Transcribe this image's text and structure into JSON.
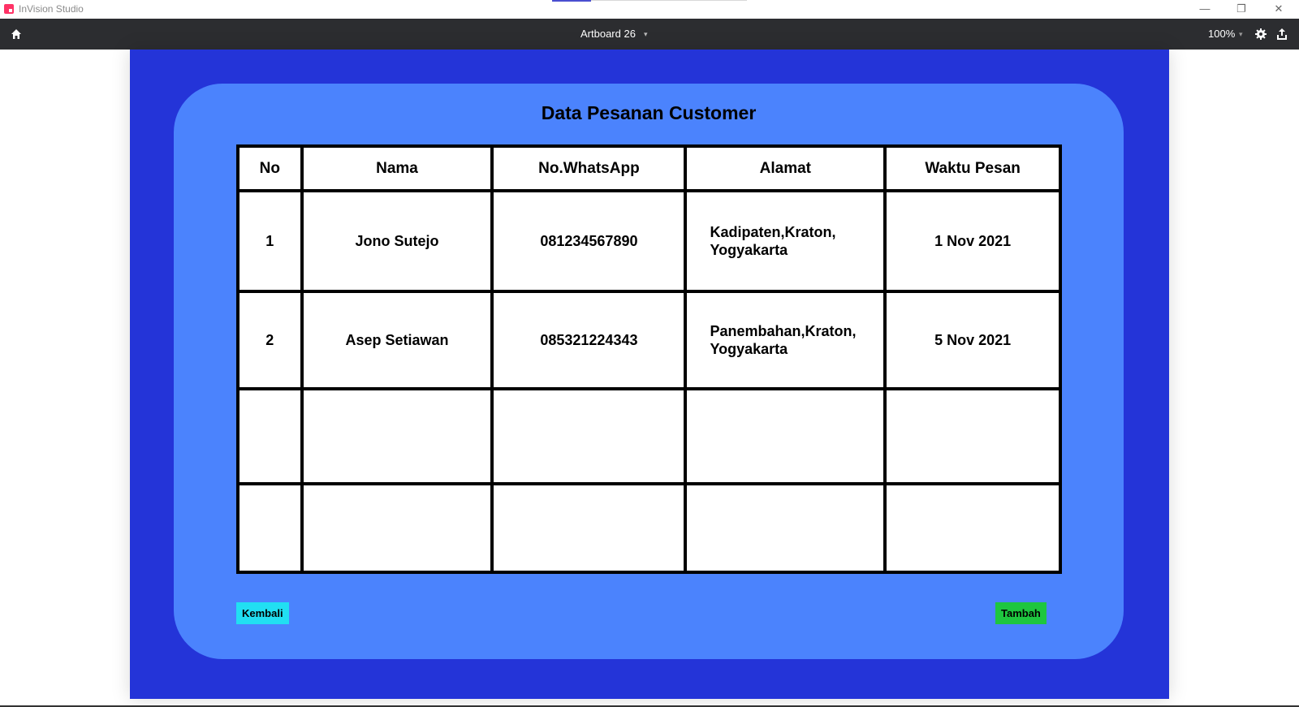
{
  "window": {
    "app_title": "InVision Studio",
    "minimize_glyph": "—",
    "maximize_glyph": "❐",
    "close_glyph": "✕"
  },
  "toolbar": {
    "artboard_name": "Artboard 26",
    "caret_glyph": "▾",
    "zoom": "100%",
    "icons": [
      "home-icon",
      "gear-icon",
      "export-icon"
    ]
  },
  "page": {
    "title": "Data Pesanan Customer",
    "colors": {
      "artboard": "#2434d8",
      "panel": "#4b83fd",
      "back_button": "#21dff2",
      "add_button": "#1ec63f"
    }
  },
  "table": {
    "headers": [
      "No",
      "Nama",
      "No.WhatsApp",
      "Alamat",
      "Waktu Pesan"
    ],
    "rows": [
      {
        "no": "1",
        "nama": "Jono Sutejo",
        "wa": "081234567890",
        "alamat_line1": "Kadipaten,Kraton,",
        "alamat_line2": "Yogyakarta",
        "waktu": "1 Nov 2021"
      },
      {
        "no": "2",
        "nama": "Asep Setiawan",
        "wa": "085321224343",
        "alamat_line1": "Panembahan,Kraton,",
        "alamat_line2": "Yogyakarta",
        "waktu": "5 Nov 2021"
      }
    ]
  },
  "buttons": {
    "back": "Kembali",
    "add": "Tambah"
  }
}
